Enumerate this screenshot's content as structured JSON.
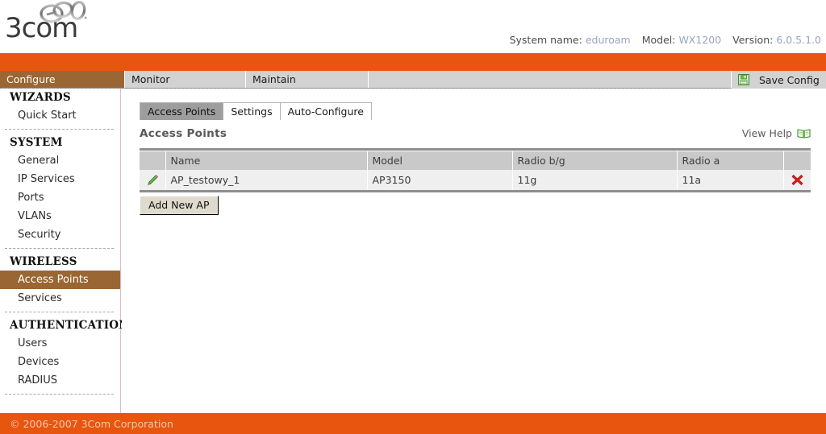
{
  "header": {
    "brand": "3com",
    "logo_icon": "3com-rings-logo",
    "sysinfo": {
      "system_name_label": "System name:",
      "system_name_value": "eduroam",
      "model_label": "Model:",
      "model_value": "WX1200",
      "version_label": "Version:",
      "version_value": "6.0.5.1.0"
    }
  },
  "nav": {
    "tabs": [
      {
        "label": "Configure",
        "active": true
      },
      {
        "label": "Monitor",
        "active": false
      },
      {
        "label": "Maintain",
        "active": false
      }
    ],
    "save_config_label": "Save Config",
    "save_config_icon": "floppy-disk-icon"
  },
  "sidebar": {
    "sections": [
      {
        "title": "WIZARDS",
        "items": [
          {
            "label": "Quick Start",
            "selected": false
          }
        ]
      },
      {
        "title": "SYSTEM",
        "items": [
          {
            "label": "General",
            "selected": false
          },
          {
            "label": "IP Services",
            "selected": false
          },
          {
            "label": "Ports",
            "selected": false
          },
          {
            "label": "VLANs",
            "selected": false
          },
          {
            "label": "Security",
            "selected": false
          }
        ]
      },
      {
        "title": "WIRELESS",
        "items": [
          {
            "label": "Access Points",
            "selected": true
          },
          {
            "label": "Services",
            "selected": false
          }
        ]
      },
      {
        "title": "AUTHENTICATION",
        "items": [
          {
            "label": "Users",
            "selected": false
          },
          {
            "label": "Devices",
            "selected": false
          },
          {
            "label": "RADIUS",
            "selected": false
          }
        ]
      }
    ]
  },
  "content": {
    "tabs": [
      {
        "label": "Access Points",
        "active": true
      },
      {
        "label": "Settings",
        "active": false
      },
      {
        "label": "Auto-Configure",
        "active": false
      }
    ],
    "page_title": "Access Points",
    "view_help_label": "View Help",
    "view_help_icon": "open-book-icon",
    "table": {
      "columns": [
        "Name",
        "Model",
        "Radio b/g",
        "Radio a"
      ],
      "rows": [
        {
          "edit_icon": "pencil-edit-icon",
          "name": "AP_testowy_1",
          "model": "AP3150",
          "radio_bg": "11g",
          "radio_a": "11a",
          "delete_icon": "red-x-delete-icon"
        }
      ]
    },
    "add_button_label": "Add New AP"
  },
  "footer": {
    "copyright": "© 2006-2007 3Com Corporation"
  },
  "colors": {
    "orange": "#e8550f",
    "selection_brown": "#9a6633",
    "nav_gray": "#9d9d9d",
    "tab_gray": "#d2d2d2",
    "value_blue": "#9aa3c4"
  }
}
